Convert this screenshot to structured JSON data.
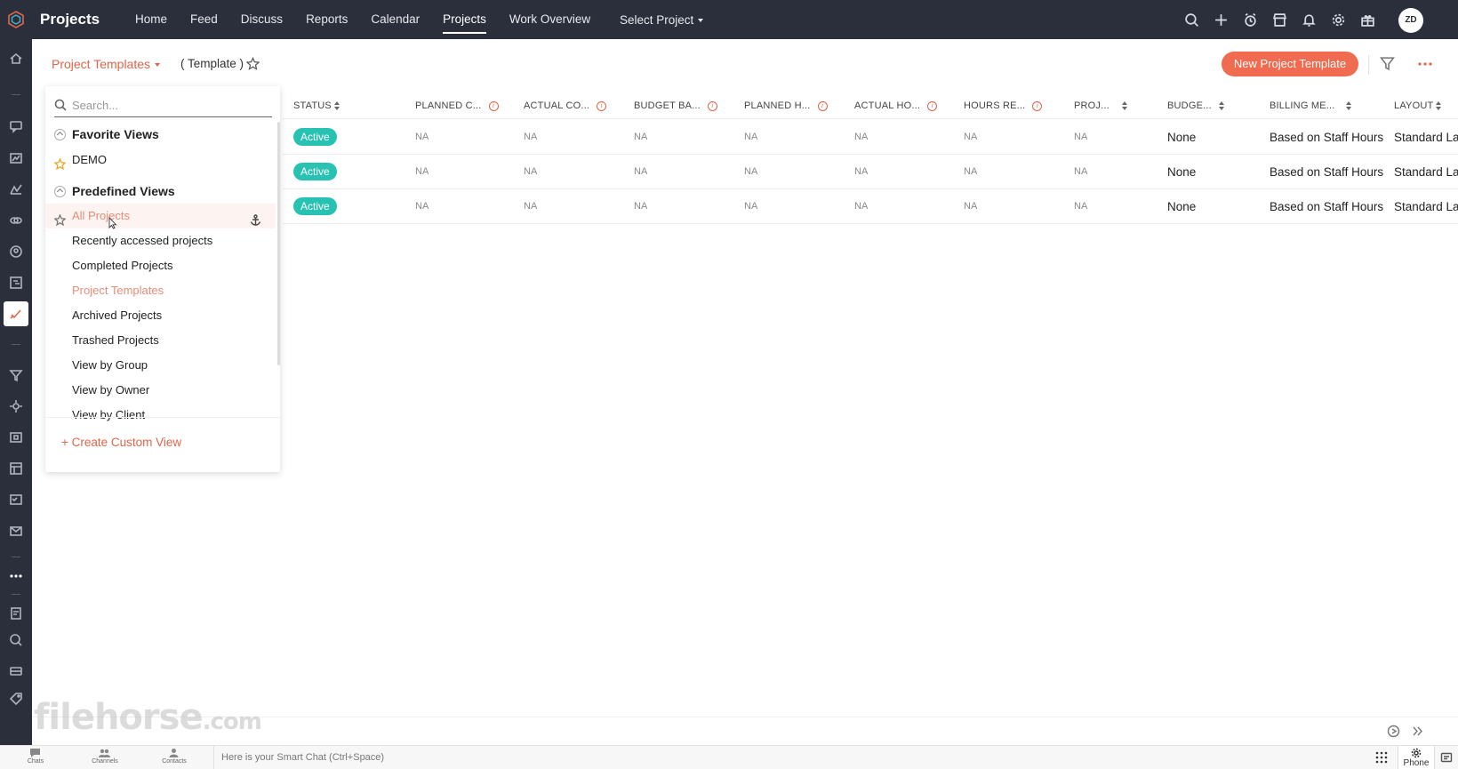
{
  "topbar": {
    "title": "Projects",
    "nav": [
      "Home",
      "Feed",
      "Discuss",
      "Reports",
      "Calendar",
      "Projects",
      "Work Overview"
    ],
    "active_nav": "Projects",
    "select_project": "Select Project",
    "avatar_initials": "ZD"
  },
  "subheader": {
    "view_title": "Project Templates",
    "template_label": "( Template )",
    "new_button": "New Project Template"
  },
  "table": {
    "columns": [
      "STATUS",
      "PLANNED C...",
      "ACTUAL CO...",
      "BUDGET BA...",
      "PLANNED H...",
      "ACTUAL HO...",
      "HOURS RE...",
      "PROJ...",
      "BUDGE...",
      "BILLING ME...",
      "LAYOUT"
    ],
    "rows": [
      [
        "Active",
        "NA",
        "NA",
        "NA",
        "NA",
        "NA",
        "NA",
        "NA",
        "None",
        "Based on Staff Hours",
        "Standard Layout"
      ],
      [
        "Active",
        "NA",
        "NA",
        "NA",
        "NA",
        "NA",
        "NA",
        "NA",
        "None",
        "Based on Staff Hours",
        "Standard Layout"
      ],
      [
        "Active",
        "NA",
        "NA",
        "NA",
        "NA",
        "NA",
        "NA",
        "NA",
        "None",
        "Based on Staff Hours",
        "Standard Layout"
      ]
    ]
  },
  "views_panel": {
    "search_placeholder": "Search...",
    "favorite_header": "Favorite Views",
    "favorites": [
      "DEMO"
    ],
    "predefined_header": "Predefined Views",
    "predefined": [
      "All Projects",
      "Recently accessed projects",
      "Completed Projects",
      "Project Templates",
      "Archived Projects",
      "Trashed Projects",
      "View by Group",
      "View by Owner",
      "View by Client"
    ],
    "create_view": "+ Create Custom View"
  },
  "watermark": {
    "text": "filehorse",
    "suffix": ".com"
  },
  "chatbar": {
    "tabs": [
      "Chats",
      "Channels",
      "Contacts"
    ],
    "placeholder": "Here is your Smart Chat (Ctrl+Space)",
    "phone": "Phone"
  },
  "colors": {
    "topbar": "#2b2f3c",
    "accent": "#e0654a",
    "button": "#f06b50",
    "status_active": "#28c2b2"
  }
}
